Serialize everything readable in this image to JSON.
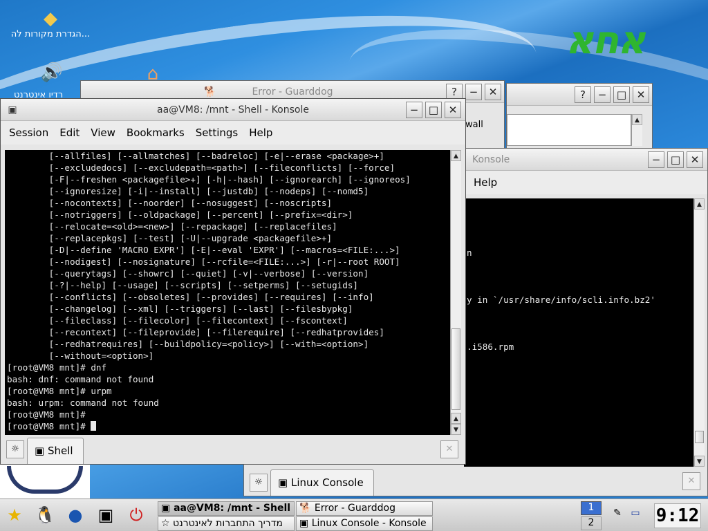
{
  "desktop": {
    "icons": [
      {
        "label": "הגדרת מקורות לה..."
      },
      {
        "label": "רדיו אינטרנט"
      }
    ],
    "logo_text": "אחא"
  },
  "guarddog_error": {
    "title": "Error - Guarddog",
    "help_btn": "?",
    "min_btn": "−",
    "close_btn": "✕",
    "visible_text": "wall"
  },
  "back_window": {
    "help_btn": "?",
    "min_btn": "−",
    "max_btn": "□",
    "close_btn": "✕"
  },
  "linux_console": {
    "title": "Linux Console - Konsole",
    "title_visible": "Konsole",
    "menu_visible": [
      "Help"
    ],
    "min_btn": "−",
    "max_btn": "□",
    "close_btn": "✕",
    "lines": [
      "",
      "",
      "",
      "",
      "n",
      "",
      "",
      "",
      "y in `/usr/share/info/scli.info.bz2'",
      "",
      "",
      "",
      ".i586.rpm"
    ],
    "tab_label": "Linux Console"
  },
  "shell_window": {
    "title": "aa@VM8: /mnt - Shell - Konsole",
    "min_btn": "−",
    "max_btn": "□",
    "close_btn": "✕",
    "menu": [
      "Session",
      "Edit",
      "View",
      "Bookmarks",
      "Settings",
      "Help"
    ],
    "lines": [
      "        [--allfiles] [--allmatches] [--badreloc] [-e|--erase <package>+]",
      "        [--excludedocs] [--excludepath=<path>] [--fileconflicts] [--force]",
      "        [-F|--freshen <packagefile>+] [-h|--hash] [--ignorearch] [--ignoreos]",
      "        [--ignoresize] [-i|--install] [--justdb] [--nodeps] [--nomd5]",
      "        [--nocontexts] [--noorder] [--nosuggest] [--noscripts]",
      "        [--notriggers] [--oldpackage] [--percent] [--prefix=<dir>]",
      "        [--relocate=<old>=<new>] [--repackage] [--replacefiles]",
      "        [--replacepkgs] [--test] [-U|--upgrade <packagefile>+]",
      "        [-D|--define 'MACRO EXPR'] [-E|--eval 'EXPR'] [--macros=<FILE:...>]",
      "        [--nodigest] [--nosignature] [--rcfile=<FILE:...>] [-r|--root ROOT]",
      "        [--querytags] [--showrc] [--quiet] [-v|--verbose] [--version]",
      "        [-?|--help] [--usage] [--scripts] [--setperms] [--setugids]",
      "        [--conflicts] [--obsoletes] [--provides] [--requires] [--info]",
      "        [--changelog] [--xml] [--triggers] [--last] [--filesbypkg]",
      "        [--fileclass] [--filecolor] [--filecontext] [--fscontext]",
      "        [--recontext] [--fileprovide] [--filerequire] [--redhatprovides]",
      "        [--redhatrequires] [--buildpolicy=<policy>] [--with=<option>]",
      "        [--without=<option>]",
      "[root@VM8 mnt]# dnf",
      "bash: dnf: command not found",
      "[root@VM8 mnt]# urpm",
      "bash: urpm: command not found",
      "[root@VM8 mnt]#",
      "[root@VM8 mnt]# "
    ],
    "tab_label": "Shell"
  },
  "taskbar": {
    "tasks": [
      {
        "label": "aa@VM8: /mnt - Shell - Konsole"
      },
      {
        "label": "Error - Guarddog"
      },
      {
        "label": "מדריך התחברות לאינטרנט"
      },
      {
        "label": "Linux Console - Konsole"
      }
    ],
    "pager": [
      "1",
      "2"
    ],
    "clock": "9:12"
  }
}
